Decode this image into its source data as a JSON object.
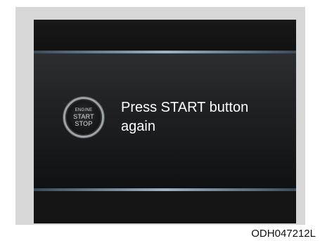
{
  "button": {
    "engine_label": "ENGINE",
    "start_label": "START",
    "stop_label": "STOP",
    "icon": "engine-start-stop-button"
  },
  "message": {
    "line1": "Press START button",
    "line2": "again"
  },
  "caption": "ODH047212L",
  "colors": {
    "screen_background": "#141414",
    "divider_accent": "#9fb3c3",
    "text": "#ffffff",
    "frame": "#d7d7d7"
  }
}
